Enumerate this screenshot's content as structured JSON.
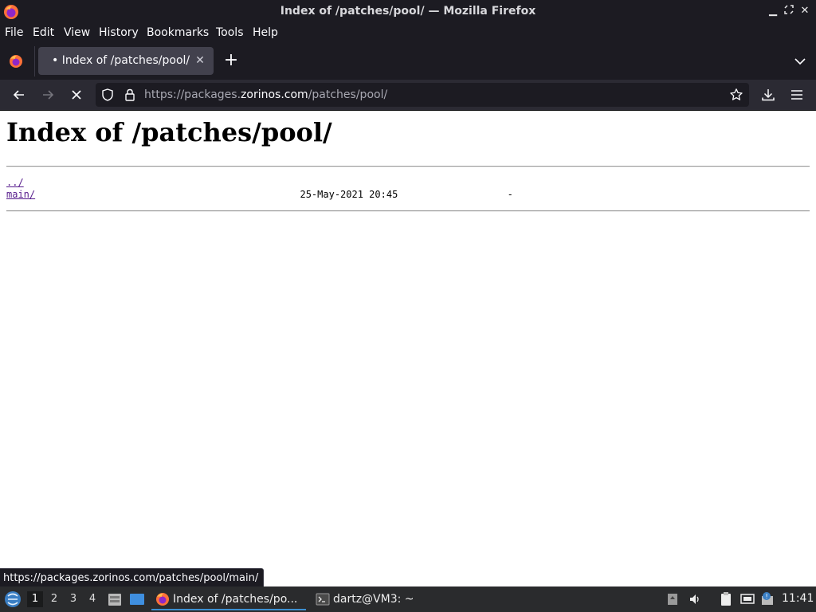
{
  "window": {
    "title": "Index of /patches/pool/ — Mozilla Firefox"
  },
  "menubar": [
    "File",
    "Edit",
    "View",
    "History",
    "Bookmarks",
    "Tools",
    "Help"
  ],
  "tabs": [
    {
      "label": "• Index of /patches/pool/",
      "active": true
    }
  ],
  "navbar": {
    "url_prefix": "https://packages.",
    "url_host": "zorinos.com",
    "url_path": "/patches/pool/"
  },
  "page": {
    "heading": "Index of /patches/pool/",
    "listing": [
      {
        "name": "../",
        "date": "",
        "size": ""
      },
      {
        "name": "main/",
        "date": "25-May-2021 20:45",
        "size": "-"
      }
    ]
  },
  "statusbar": {
    "link": "https://packages.zorinos.com/patches/pool/main/"
  },
  "taskbar": {
    "workspaces": [
      "1",
      "2",
      "3",
      "4"
    ],
    "active_workspace": "1",
    "tasks": [
      {
        "label": "Index of /patches/po...",
        "icon": "firefox-icon",
        "active": true
      },
      {
        "label": "dartz@VM3: ~",
        "icon": "terminal-icon",
        "active": false
      }
    ],
    "clock": "11:41"
  },
  "colors": {
    "chrome_dark": "#1c1b22",
    "toolbar": "#2b2a33",
    "tab_active": "#42414d",
    "link_visited": "#551a8b",
    "taskbar": "#2a2b2d",
    "active_task_underline": "#3d8fd1"
  }
}
